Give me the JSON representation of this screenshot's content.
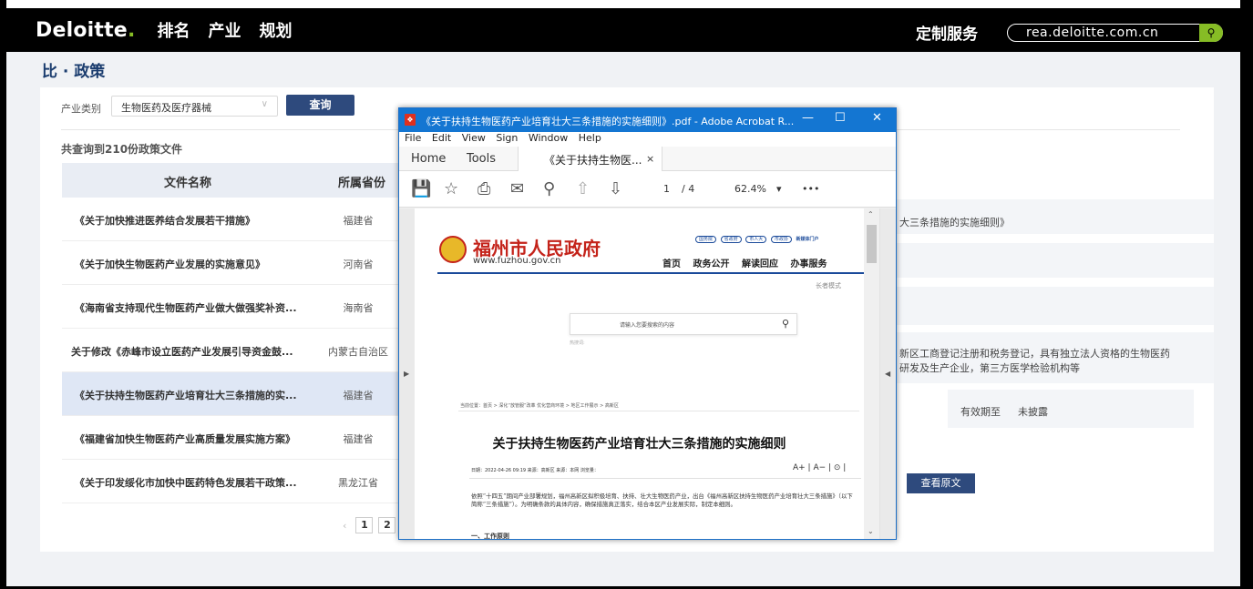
{
  "header": {
    "logo": "Deloitte",
    "logo_dot": ".",
    "nav": [
      "排名",
      "产业",
      "规划"
    ],
    "custom_service": "定制服务",
    "site_url": "rea.deloitte.com.cn"
  },
  "page": {
    "title": "比 · 政策",
    "filter_label": "产业类别",
    "filter_value": "生物医药及医疗器械",
    "query_button": "查询",
    "count_text": "共查询到210份政策文件",
    "columns": {
      "name": "文件名称",
      "province": "所属省份"
    },
    "rows": [
      {
        "name": "《关于加快推进医养结合发展若干措施》",
        "province": "福建省"
      },
      {
        "name": "《关于加快生物医药产业发展的实施意见》",
        "province": "河南省"
      },
      {
        "name": "《海南省支持现代生物医药产业做大做强奖补资...",
        "province": "海南省"
      },
      {
        "name": "关于修改《赤峰市设立医药产业发展引导资金鼓...",
        "province": "内蒙古自治区"
      },
      {
        "name": "《关于扶持生物医药产业培育壮大三条措施的实...",
        "province": "福建省"
      },
      {
        "name": "《福建省加快生物医药产业高质量发展实施方案》",
        "province": "福建省"
      },
      {
        "name": "《关于印发绥化市加快中医药特色发展若干政策...",
        "province": "黑龙江省"
      }
    ],
    "pager": {
      "prev": "‹",
      "page1": "1",
      "page2": "2"
    }
  },
  "detail": {
    "title_partial": "大三条措施的实施细则》",
    "desc_line1": "新区工商登记注册和税务登记，具有独立法人资格的生物医药",
    "desc_line2": "研发及生产企业，第三方医学检验机构等",
    "expire_label": "有效期至",
    "expire_value": "未披露",
    "view_button": "查看原文"
  },
  "acrobat": {
    "title": "《关于扶持生物医药产业培育壮大三条措施的实施细则》.pdf - Adobe Acrobat R...",
    "min": "—",
    "max": "☐",
    "close": "✕",
    "menu": [
      "File",
      "Edit",
      "View",
      "Sign",
      "Window",
      "Help"
    ],
    "tab_home": "Home",
    "tab_tools": "Tools",
    "tab_doc": "《关于扶持生物医...",
    "tab_close": "×",
    "page_current": "1",
    "page_total": "/ 4",
    "zoom": "62.4%",
    "more": "•••",
    "doc": {
      "gov_name": "福州市人民政府",
      "gov_url": "www.fuzhou.gov.cn",
      "gov_links": [
        "国务院",
        "省政府",
        "市人大",
        "市政协",
        "新媒体门户"
      ],
      "gov_nav": [
        "首页",
        "政务公开",
        "解读回应",
        "办事服务"
      ],
      "gov_sub": "长者模式",
      "search_placeholder": "请输入您要搜索的内容",
      "hot": "热搜词:",
      "crumb": "当前位置：首页 > 深化“放管服”改革 优化营商环境 > 地区工作展示 > 高新区",
      "article_title": "关于扶持生物医药产业培育壮大三条措施的实施细则",
      "meta": "日期：2022-04-26 09:19   来源：高新区   来源：本网   浏览量：",
      "tools": "A+  |  A−  |  ⊙  |",
      "body": "依照“十四五”期间产业部署规划，福州高新区拟积极培育、扶持、壮大生物医药产业，出台《福州高新区扶持生物医药产业培育壮大三条措施》（以下简称“三条措施”）。为明确条款的具体内容，确保措施真正落实，结合本区产业发展实际，制定本细则。",
      "section": "一、工作原则"
    }
  }
}
